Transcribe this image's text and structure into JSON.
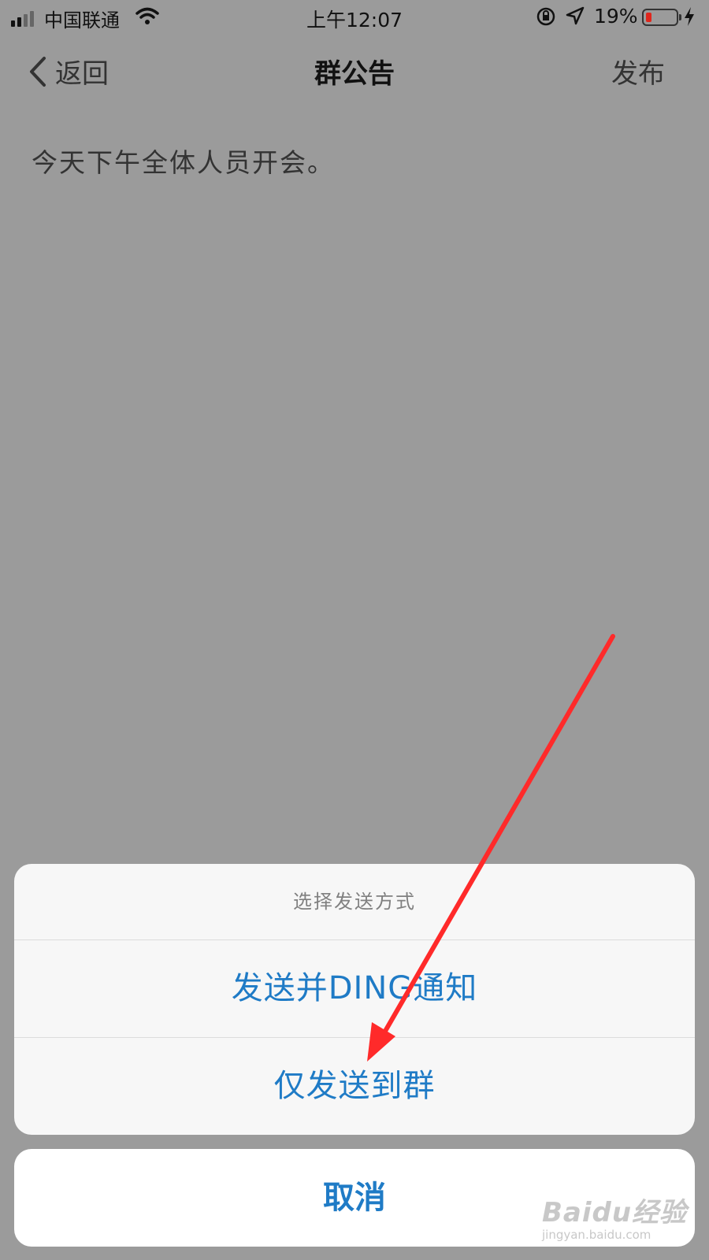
{
  "status_bar": {
    "carrier": "中国联通",
    "time": "上午12:07",
    "battery_percent": "19%",
    "battery_level": 0.19
  },
  "nav": {
    "back_label": "返回",
    "title": "群公告",
    "publish_label": "发布"
  },
  "content": {
    "announcement_text": "今天下午全体人员开会。"
  },
  "action_sheet": {
    "title": "选择发送方式",
    "options": [
      {
        "label": "发送并DING通知"
      },
      {
        "label": "仅发送到群"
      }
    ],
    "cancel_label": "取消"
  },
  "watermark": {
    "logo": "Baidu经验",
    "url": "jingyan.baidu.com"
  },
  "colors": {
    "accent": "#1f7bc6",
    "arrow": "#ff2a2a",
    "dim_overlay": "#9b9b9b"
  },
  "icons": [
    "signal-icon",
    "wifi-icon",
    "rotation-lock-icon",
    "location-icon",
    "battery-icon",
    "charging-icon",
    "chevron-left-icon",
    "arrow-annotation-icon"
  ]
}
